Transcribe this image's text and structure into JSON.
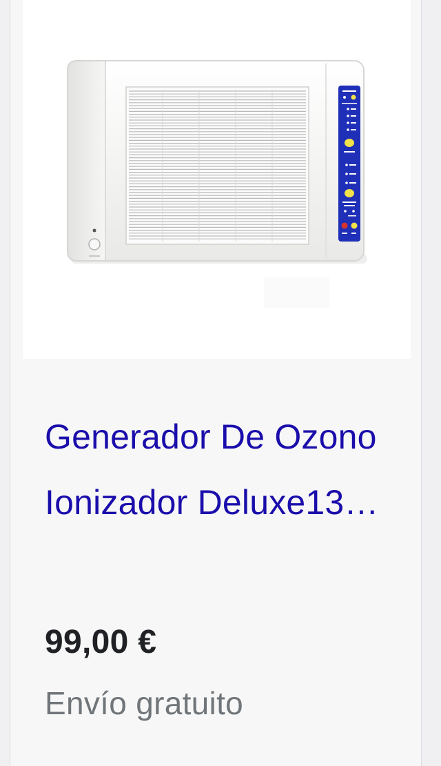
{
  "product": {
    "title": "Generador De Ozono Ionizador Deluxe13…",
    "price": "99,00 €",
    "shipping": "Envío gratuito",
    "image": {
      "panel_color": "#1f2fb8",
      "button_color": "#f2e24a",
      "off_button_color": "#d9342b",
      "body_color": "#f4f4f2",
      "grille_line_color": "#b9b9b9"
    }
  }
}
